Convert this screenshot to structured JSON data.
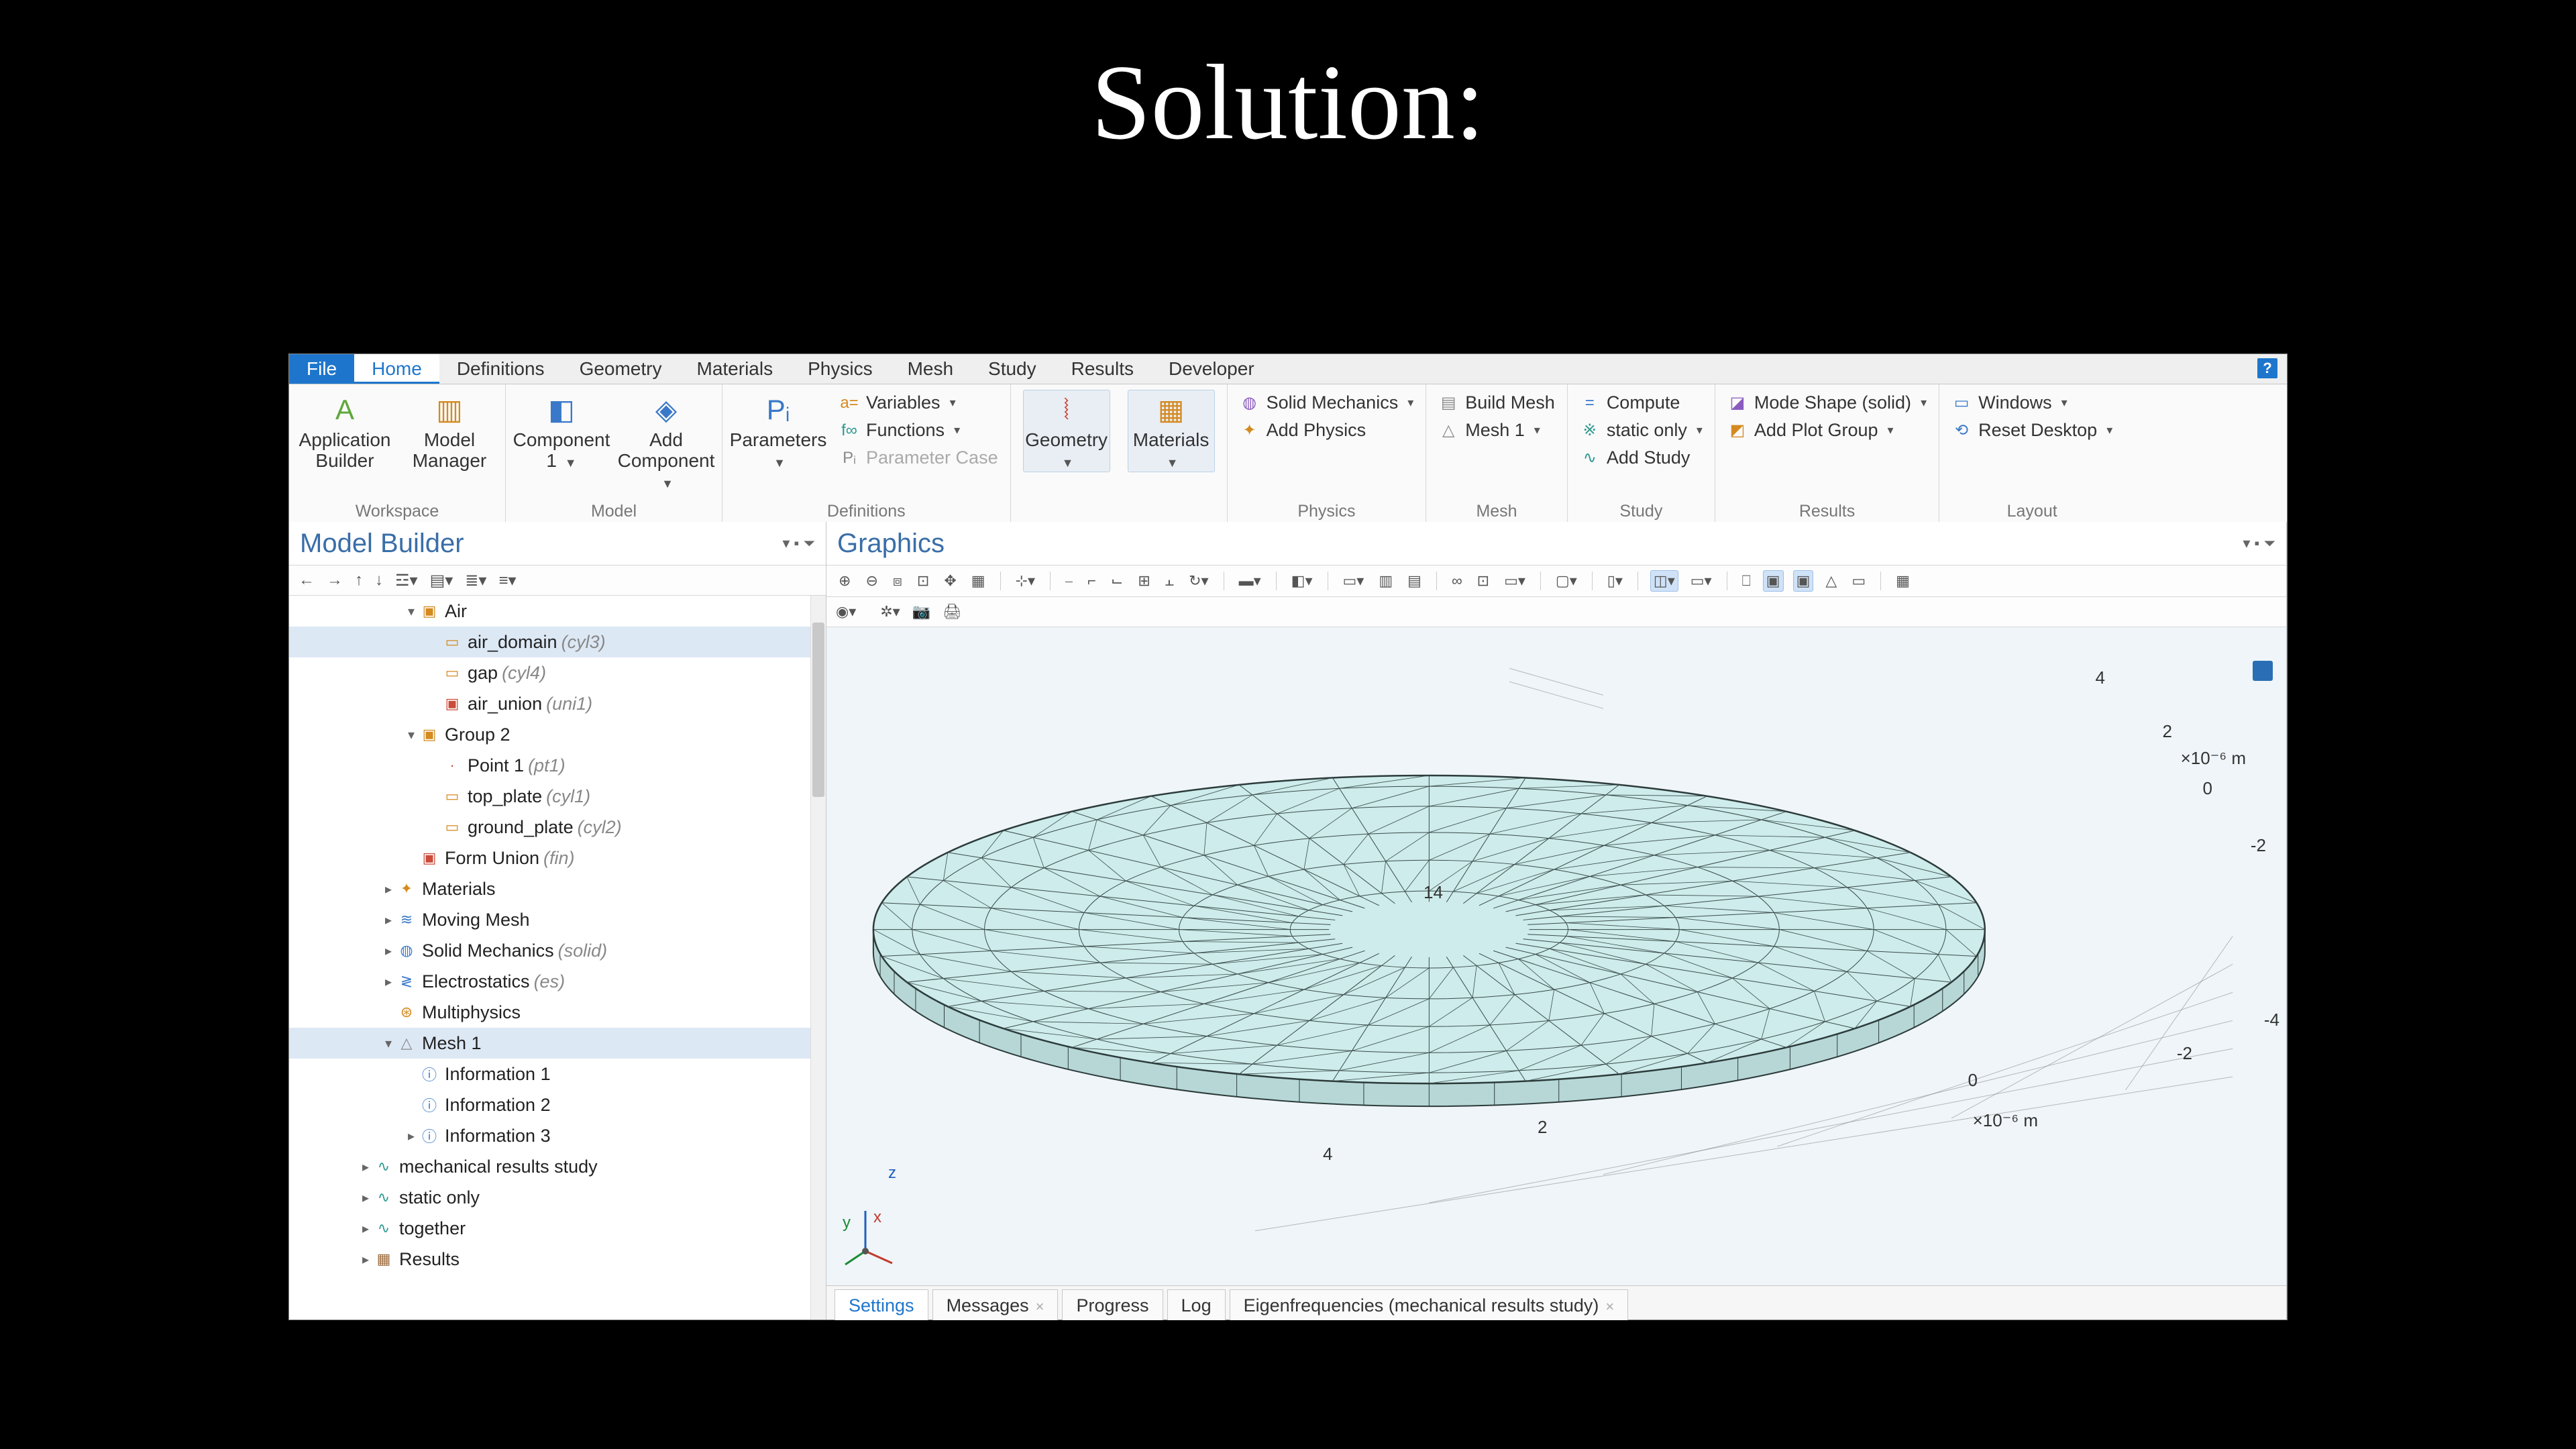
{
  "slide": {
    "title": "Solution:"
  },
  "menubar": {
    "items": [
      "File",
      "Home",
      "Definitions",
      "Geometry",
      "Materials",
      "Physics",
      "Mesh",
      "Study",
      "Results",
      "Developer"
    ],
    "file_index": 0,
    "active_index": 1
  },
  "help": {
    "symbol": "?"
  },
  "ribbon": {
    "groups": {
      "workspace": {
        "label": "Workspace",
        "items": [
          {
            "label": "Application Builder",
            "icon": "A",
            "cls": "c-green"
          },
          {
            "label": "Model Manager",
            "icon": "▥",
            "cls": "c-orange"
          }
        ]
      },
      "model": {
        "label": "Model",
        "items": [
          {
            "label": "Component 1",
            "icon": "◧",
            "cls": "c-blue",
            "dd": true
          },
          {
            "label": "Add Component",
            "icon": "◈",
            "cls": "c-blue",
            "dd": true
          }
        ]
      },
      "definitions": {
        "label": "Definitions",
        "big": {
          "label": "Parameters",
          "icon": "Pᵢ",
          "cls": "c-blue",
          "dd": true
        },
        "small": [
          {
            "label": "Variables",
            "icon": "a=",
            "cls": "c-orange",
            "dd": true
          },
          {
            "label": "Functions",
            "icon": "f∞",
            "cls": "c-teal",
            "dd": true
          },
          {
            "label": "Parameter Case",
            "icon": "Pᵢ",
            "cls": "c-gray",
            "dis": true
          }
        ]
      },
      "mid": {
        "label": "",
        "items": [
          {
            "label": "Geometry",
            "icon": "⦚",
            "cls": "c-red",
            "dd": true,
            "sel": true
          },
          {
            "label": "Materials",
            "icon": "▦",
            "cls": "c-orange",
            "dd": true,
            "sel": true
          }
        ]
      },
      "physics": {
        "label": "Physics",
        "small": [
          {
            "label": "Solid Mechanics",
            "icon": "◍",
            "cls": "c-purple",
            "dd": true
          },
          {
            "label": "Add Physics",
            "icon": "✦",
            "cls": "c-orange"
          }
        ]
      },
      "mesh": {
        "label": "Mesh",
        "small": [
          {
            "label": "Build Mesh",
            "icon": "▤",
            "cls": "c-gray"
          },
          {
            "label": "Mesh 1",
            "icon": "△",
            "cls": "c-gray",
            "dd": true
          }
        ]
      },
      "study": {
        "label": "Study",
        "small": [
          {
            "label": "Compute",
            "icon": "=",
            "cls": "c-blue"
          },
          {
            "label": "static only",
            "icon": "※",
            "cls": "c-teal",
            "dd": true
          },
          {
            "label": "Add Study",
            "icon": "∿",
            "cls": "c-teal"
          }
        ]
      },
      "results": {
        "label": "Results",
        "small": [
          {
            "label": "Mode Shape (solid)",
            "icon": "◪",
            "cls": "c-purple",
            "dd": true
          },
          {
            "label": "Add Plot Group",
            "icon": "◩",
            "cls": "c-orange",
            "dd": true
          }
        ]
      },
      "layout": {
        "label": "Layout",
        "small": [
          {
            "label": "Windows",
            "icon": "▭",
            "cls": "c-blue",
            "dd": true
          },
          {
            "label": "Reset Desktop",
            "icon": "⟲",
            "cls": "c-blue",
            "dd": true
          }
        ]
      }
    }
  },
  "model_builder": {
    "title": "Model Builder",
    "toolbar": [
      "←",
      "→",
      "↑",
      "↓",
      "☲▾",
      "▤▾",
      "≣▾",
      "≡▾"
    ],
    "nodes": [
      {
        "d": 5,
        "exp": "▾",
        "icon": "▣",
        "cls": "c-orange",
        "label": "Air"
      },
      {
        "d": 6,
        "icon": "▭",
        "cls": "c-orange",
        "label": "air_domain",
        "suffix": "(cyl3)",
        "sel": true
      },
      {
        "d": 6,
        "icon": "▭",
        "cls": "c-orange",
        "label": "gap",
        "suffix": "(cyl4)"
      },
      {
        "d": 6,
        "icon": "▣",
        "cls": "c-red",
        "label": "air_union",
        "suffix": "(uni1)"
      },
      {
        "d": 5,
        "exp": "▾",
        "icon": "▣",
        "cls": "c-orange",
        "label": "Group 2"
      },
      {
        "d": 6,
        "icon": "·",
        "cls": "c-red",
        "label": "Point 1",
        "suffix": "(pt1)"
      },
      {
        "d": 6,
        "icon": "▭",
        "cls": "c-orange",
        "label": "top_plate",
        "suffix": "(cyl1)"
      },
      {
        "d": 6,
        "icon": "▭",
        "cls": "c-orange",
        "label": "ground_plate",
        "suffix": "(cyl2)"
      },
      {
        "d": 5,
        "icon": "▣",
        "cls": "c-red",
        "label": "Form Union",
        "suffix": "(fin)"
      },
      {
        "d": 4,
        "exp": "▸",
        "icon": "✦",
        "cls": "c-orange",
        "label": "Materials"
      },
      {
        "d": 4,
        "exp": "▸",
        "icon": "≋",
        "cls": "c-blue",
        "label": "Moving Mesh"
      },
      {
        "d": 4,
        "exp": "▸",
        "icon": "◍",
        "cls": "c-blue",
        "label": "Solid Mechanics",
        "suffix": "(solid)"
      },
      {
        "d": 4,
        "exp": "▸",
        "icon": "≷",
        "cls": "c-blue",
        "label": "Electrostatics",
        "suffix": "(es)"
      },
      {
        "d": 4,
        "icon": "⊛",
        "cls": "c-orange",
        "label": "Multiphysics"
      },
      {
        "d": 4,
        "exp": "▾",
        "icon": "△",
        "cls": "c-gray",
        "label": "Mesh 1",
        "sel": true
      },
      {
        "d": 5,
        "icon": "ⓘ",
        "cls": "c-blue",
        "label": "Information 1"
      },
      {
        "d": 5,
        "icon": "ⓘ",
        "cls": "c-blue",
        "label": "Information 2"
      },
      {
        "d": 5,
        "exp": "▸",
        "icon": "ⓘ",
        "cls": "c-blue",
        "label": "Information 3"
      },
      {
        "d": 3,
        "exp": "▸",
        "icon": "∿",
        "cls": "c-teal",
        "label": "mechanical results study"
      },
      {
        "d": 3,
        "exp": "▸",
        "icon": "∿",
        "cls": "c-teal",
        "label": "static only"
      },
      {
        "d": 3,
        "exp": "▸",
        "icon": "∿",
        "cls": "c-teal",
        "label": "together"
      },
      {
        "d": 3,
        "exp": "▸",
        "icon": "▦",
        "cls": "c-brown",
        "label": "Results"
      }
    ]
  },
  "graphics": {
    "title": "Graphics",
    "toolbar1": [
      "⊕",
      "⊖",
      "⧈",
      "⊡",
      "✥",
      "▦",
      "",
      "⊹▾",
      "",
      "⎯",
      "⌐",
      "⌙",
      "⊞",
      "⫠",
      "↻▾",
      "",
      "▬▾",
      "",
      "◧▾",
      "",
      "▭▾",
      "▥",
      "▤",
      "",
      "∞",
      "⊡",
      "▭▾",
      "",
      "▢▾",
      "",
      "▯▾",
      "",
      "◫▾",
      "▭▾",
      "",
      "⎕",
      "▣",
      "▣",
      "△",
      "▭",
      "",
      "▦"
    ],
    "toolbar2": [
      "◉▾",
      "",
      "✲▾",
      "📷",
      "🖨"
    ],
    "face_label": "14",
    "axis_labels": {
      "x_unit": "×10⁻⁶ m",
      "y_unit": "×10⁻⁶ m",
      "ticks_bottom": [
        "4",
        "2",
        "0"
      ],
      "ticks_right_top": [
        "4",
        "2",
        "0"
      ],
      "ticks_right_z": [
        "0",
        "-2",
        "-4"
      ],
      "ticks_left_z": [
        "-2"
      ]
    },
    "triad": {
      "x": "x",
      "y": "y",
      "z": "z"
    }
  },
  "bottom_tabs": [
    {
      "label": "Settings",
      "active": true
    },
    {
      "label": "Messages",
      "close": true
    },
    {
      "label": "Progress"
    },
    {
      "label": "Log"
    },
    {
      "label": "Eigenfrequencies (mechanical results study)",
      "close": true
    }
  ]
}
